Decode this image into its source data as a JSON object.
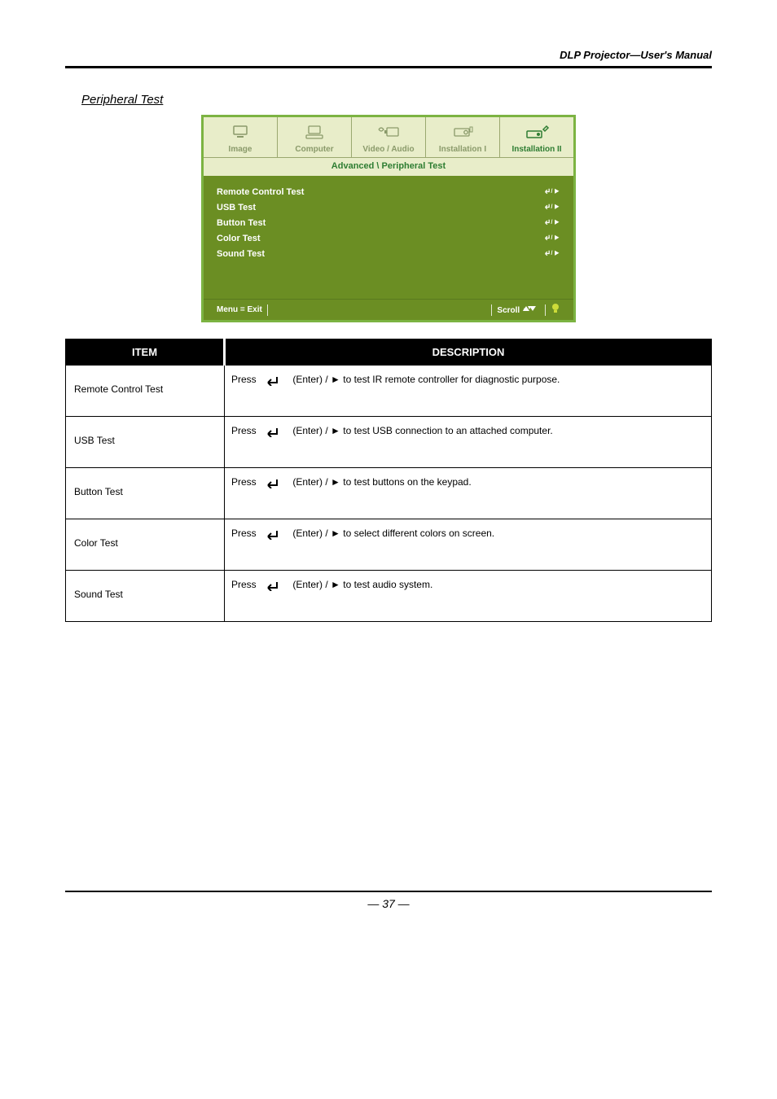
{
  "product_title": "DLP Projector—User's Manual",
  "section_title": "Peripheral Test",
  "osd": {
    "tabs": [
      {
        "label": "Image",
        "icon": "monitor"
      },
      {
        "label": "Computer",
        "icon": "computer"
      },
      {
        "label": "Video / Audio",
        "icon": "video-audio"
      },
      {
        "label": "Installation I",
        "icon": "install1"
      },
      {
        "label": "Installation II",
        "icon": "install2",
        "active": true
      }
    ],
    "breadcrumb": "Advanced \\ Peripheral Test",
    "rows": [
      {
        "label": "Remote Control Test"
      },
      {
        "label": "USB Test"
      },
      {
        "label": "Button Test"
      },
      {
        "label": "Color Test"
      },
      {
        "label": "Sound Test"
      }
    ],
    "footer": {
      "left": "Menu = Exit",
      "right": "Scroll"
    }
  },
  "table": {
    "headers": [
      "ITEM",
      "DESCRIPTION"
    ],
    "rows": [
      {
        "item": "Remote Control Test",
        "pre": "Press ",
        "post": " (Enter) / ► to test IR remote controller for diagnostic purpose."
      },
      {
        "item": "USB Test",
        "pre": "Press ",
        "post": " (Enter) / ► to test USB connection to an attached computer."
      },
      {
        "item": "Button Test",
        "pre": "Press ",
        "post": " (Enter) / ► to test buttons on the keypad."
      },
      {
        "item": "Color Test",
        "pre": "Press ",
        "post": " (Enter) / ► to select different colors on screen."
      },
      {
        "item": "Sound Test",
        "pre": "Press ",
        "post": " (Enter) / ► to test audio system."
      }
    ]
  },
  "page_number": "— 37 —"
}
